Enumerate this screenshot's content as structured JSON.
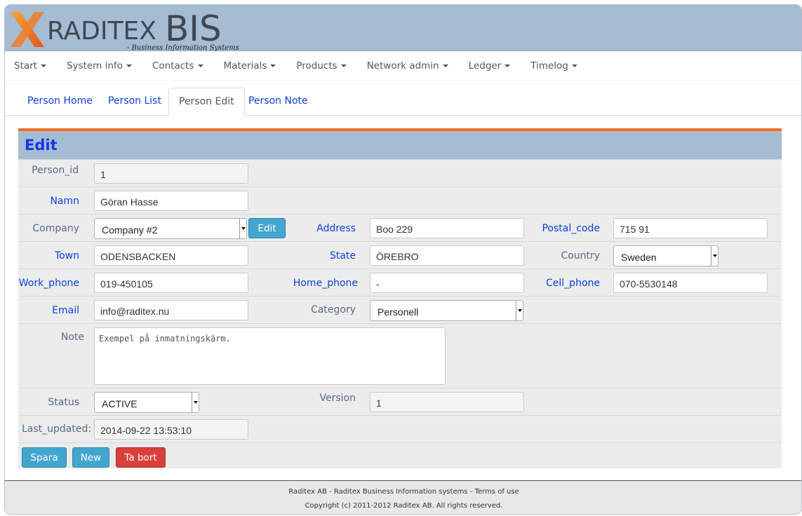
{
  "brand": {
    "name_part1": "RADITEX",
    "name_part2": "BIS",
    "tagline": "- Business Information Systems",
    "accent_orange": "#f26d21",
    "header_blue": "#a5bcd3"
  },
  "menu": [
    {
      "label": "Start"
    },
    {
      "label": "System info"
    },
    {
      "label": "Contacts"
    },
    {
      "label": "Materials"
    },
    {
      "label": "Products"
    },
    {
      "label": "Network admin"
    },
    {
      "label": "Ledger"
    },
    {
      "label": "Timelog"
    }
  ],
  "tabs": [
    {
      "label": "Person Home"
    },
    {
      "label": "Person List"
    },
    {
      "label": "Person Edit",
      "active": true
    },
    {
      "label": "Person Note"
    }
  ],
  "form": {
    "title": "Edit",
    "person_id": {
      "label": "Person_id",
      "value": "1"
    },
    "namn": {
      "label": "Namn",
      "value": "Göran Hasse"
    },
    "company": {
      "label": "Company",
      "value": "Company #2",
      "edit_button": "Edit"
    },
    "address": {
      "label": "Address",
      "value": "Boo 229"
    },
    "postal_code": {
      "label": "Postal_code",
      "value": "715 91"
    },
    "town": {
      "label": "Town",
      "value": "ODENSBACKEN"
    },
    "state": {
      "label": "State",
      "value": "ÖREBRO"
    },
    "country": {
      "label": "Country",
      "value": "Sweden"
    },
    "work_phone": {
      "label": "Work_phone",
      "value": "019-450105"
    },
    "home_phone": {
      "label": "Home_phone",
      "value": "-"
    },
    "cell_phone": {
      "label": "Cell_phone",
      "value": "070-5530148"
    },
    "email": {
      "label": "Email",
      "value": "info@raditex.nu"
    },
    "category": {
      "label": "Category",
      "value": "Personell"
    },
    "note": {
      "label": "Note",
      "value": "Exempel på inmatningskärm."
    },
    "status": {
      "label": "Status",
      "value": "ACTIVE"
    },
    "version": {
      "label": "Version",
      "value": "1"
    },
    "last_updated": {
      "label": "Last_updated:",
      "value": "2014-09-22 13:53:10"
    }
  },
  "actions": {
    "save": "Spara",
    "new": "New",
    "delete": "Ta bort"
  },
  "footer": {
    "line1": "Raditex AB  -  Raditex Business Information systems  -  Terms of use",
    "line2": "Copyright (c) 2011-2012 Raditex AB. All rights reserved."
  }
}
